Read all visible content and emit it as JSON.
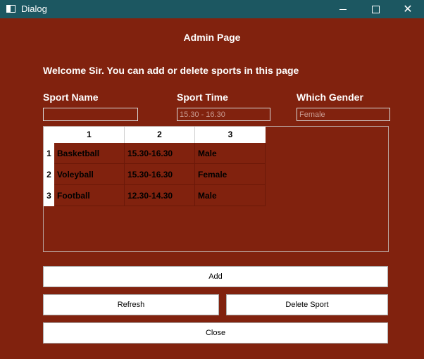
{
  "window": {
    "title": "Dialog",
    "icon": "app-window-icon"
  },
  "header": {
    "title": "Admin Page"
  },
  "welcome": "Welcome Sir. You can add or delete sports in this page",
  "fields": {
    "sport_name": {
      "label": "Sport Name",
      "value": "",
      "placeholder": ""
    },
    "sport_time": {
      "label": "Sport Time",
      "value": "",
      "placeholder": "15.30 - 16.30"
    },
    "gender": {
      "label": "Which Gender",
      "value": "",
      "placeholder": "Female"
    }
  },
  "table": {
    "columns": [
      "1",
      "2",
      "3"
    ],
    "rows": [
      {
        "num": "1",
        "cells": [
          "Basketball",
          "15.30-16.30",
          "Male"
        ]
      },
      {
        "num": "2",
        "cells": [
          "Voleyball",
          "15.30-16.30",
          "Female"
        ]
      },
      {
        "num": "3",
        "cells": [
          "Football",
          "12.30-14.30",
          "Male"
        ]
      }
    ]
  },
  "buttons": {
    "add": "Add",
    "refresh": "Refresh",
    "delete": "Delete Sport",
    "close": "Close"
  },
  "colors": {
    "background": "#81220e",
    "titlebar": "#1c5761"
  }
}
